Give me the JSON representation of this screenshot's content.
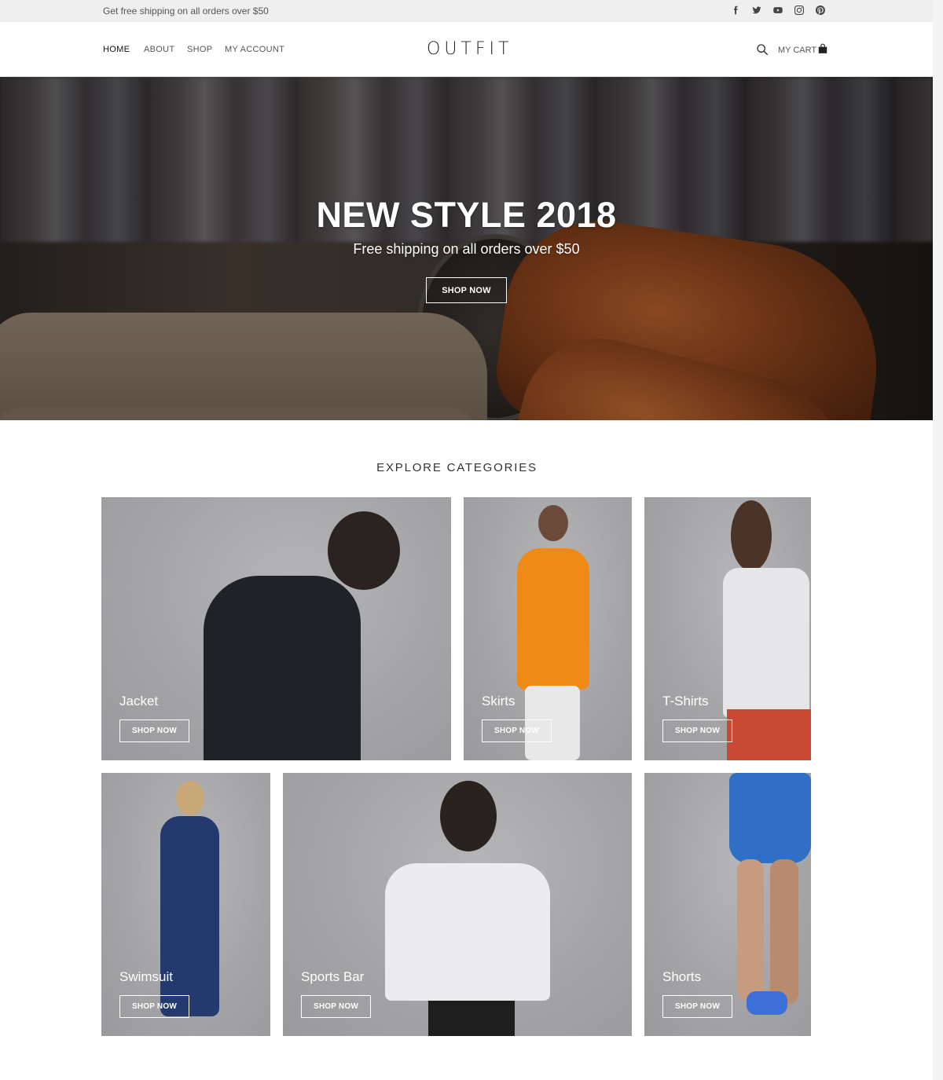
{
  "topbar": {
    "text": "Get free shipping on all orders over $50",
    "social": [
      "facebook-icon",
      "twitter-icon",
      "youtube-icon",
      "instagram-icon",
      "pinterest-icon"
    ]
  },
  "header": {
    "nav": [
      {
        "label": "HOME",
        "active": true
      },
      {
        "label": "ABOUT",
        "active": false
      },
      {
        "label": "SHOP",
        "active": false
      },
      {
        "label": "MY ACCOUNT",
        "active": false
      }
    ],
    "logo": "OUTFIT",
    "cart_label": "MY CART"
  },
  "hero": {
    "title": "NEW STYLE 2018",
    "subtitle": "Free shipping on all orders over $50",
    "button": "SHOP NOW"
  },
  "categories": {
    "title": "EXPLORE CATEGORIES",
    "items": [
      {
        "label": "Jacket",
        "button": "SHOP NOW"
      },
      {
        "label": "Skirts",
        "button": "SHOP NOW"
      },
      {
        "label": "T-Shirts",
        "button": "SHOP NOW"
      },
      {
        "label": "Swimsuit",
        "button": "SHOP NOW"
      },
      {
        "label": "Sports Bar",
        "button": "SHOP NOW"
      },
      {
        "label": "Shorts",
        "button": "SHOP NOW"
      }
    ]
  },
  "colors": {
    "topbar_bg": "#efefef",
    "tile_bg": "#a9a9aa",
    "text_dark": "#222222"
  }
}
